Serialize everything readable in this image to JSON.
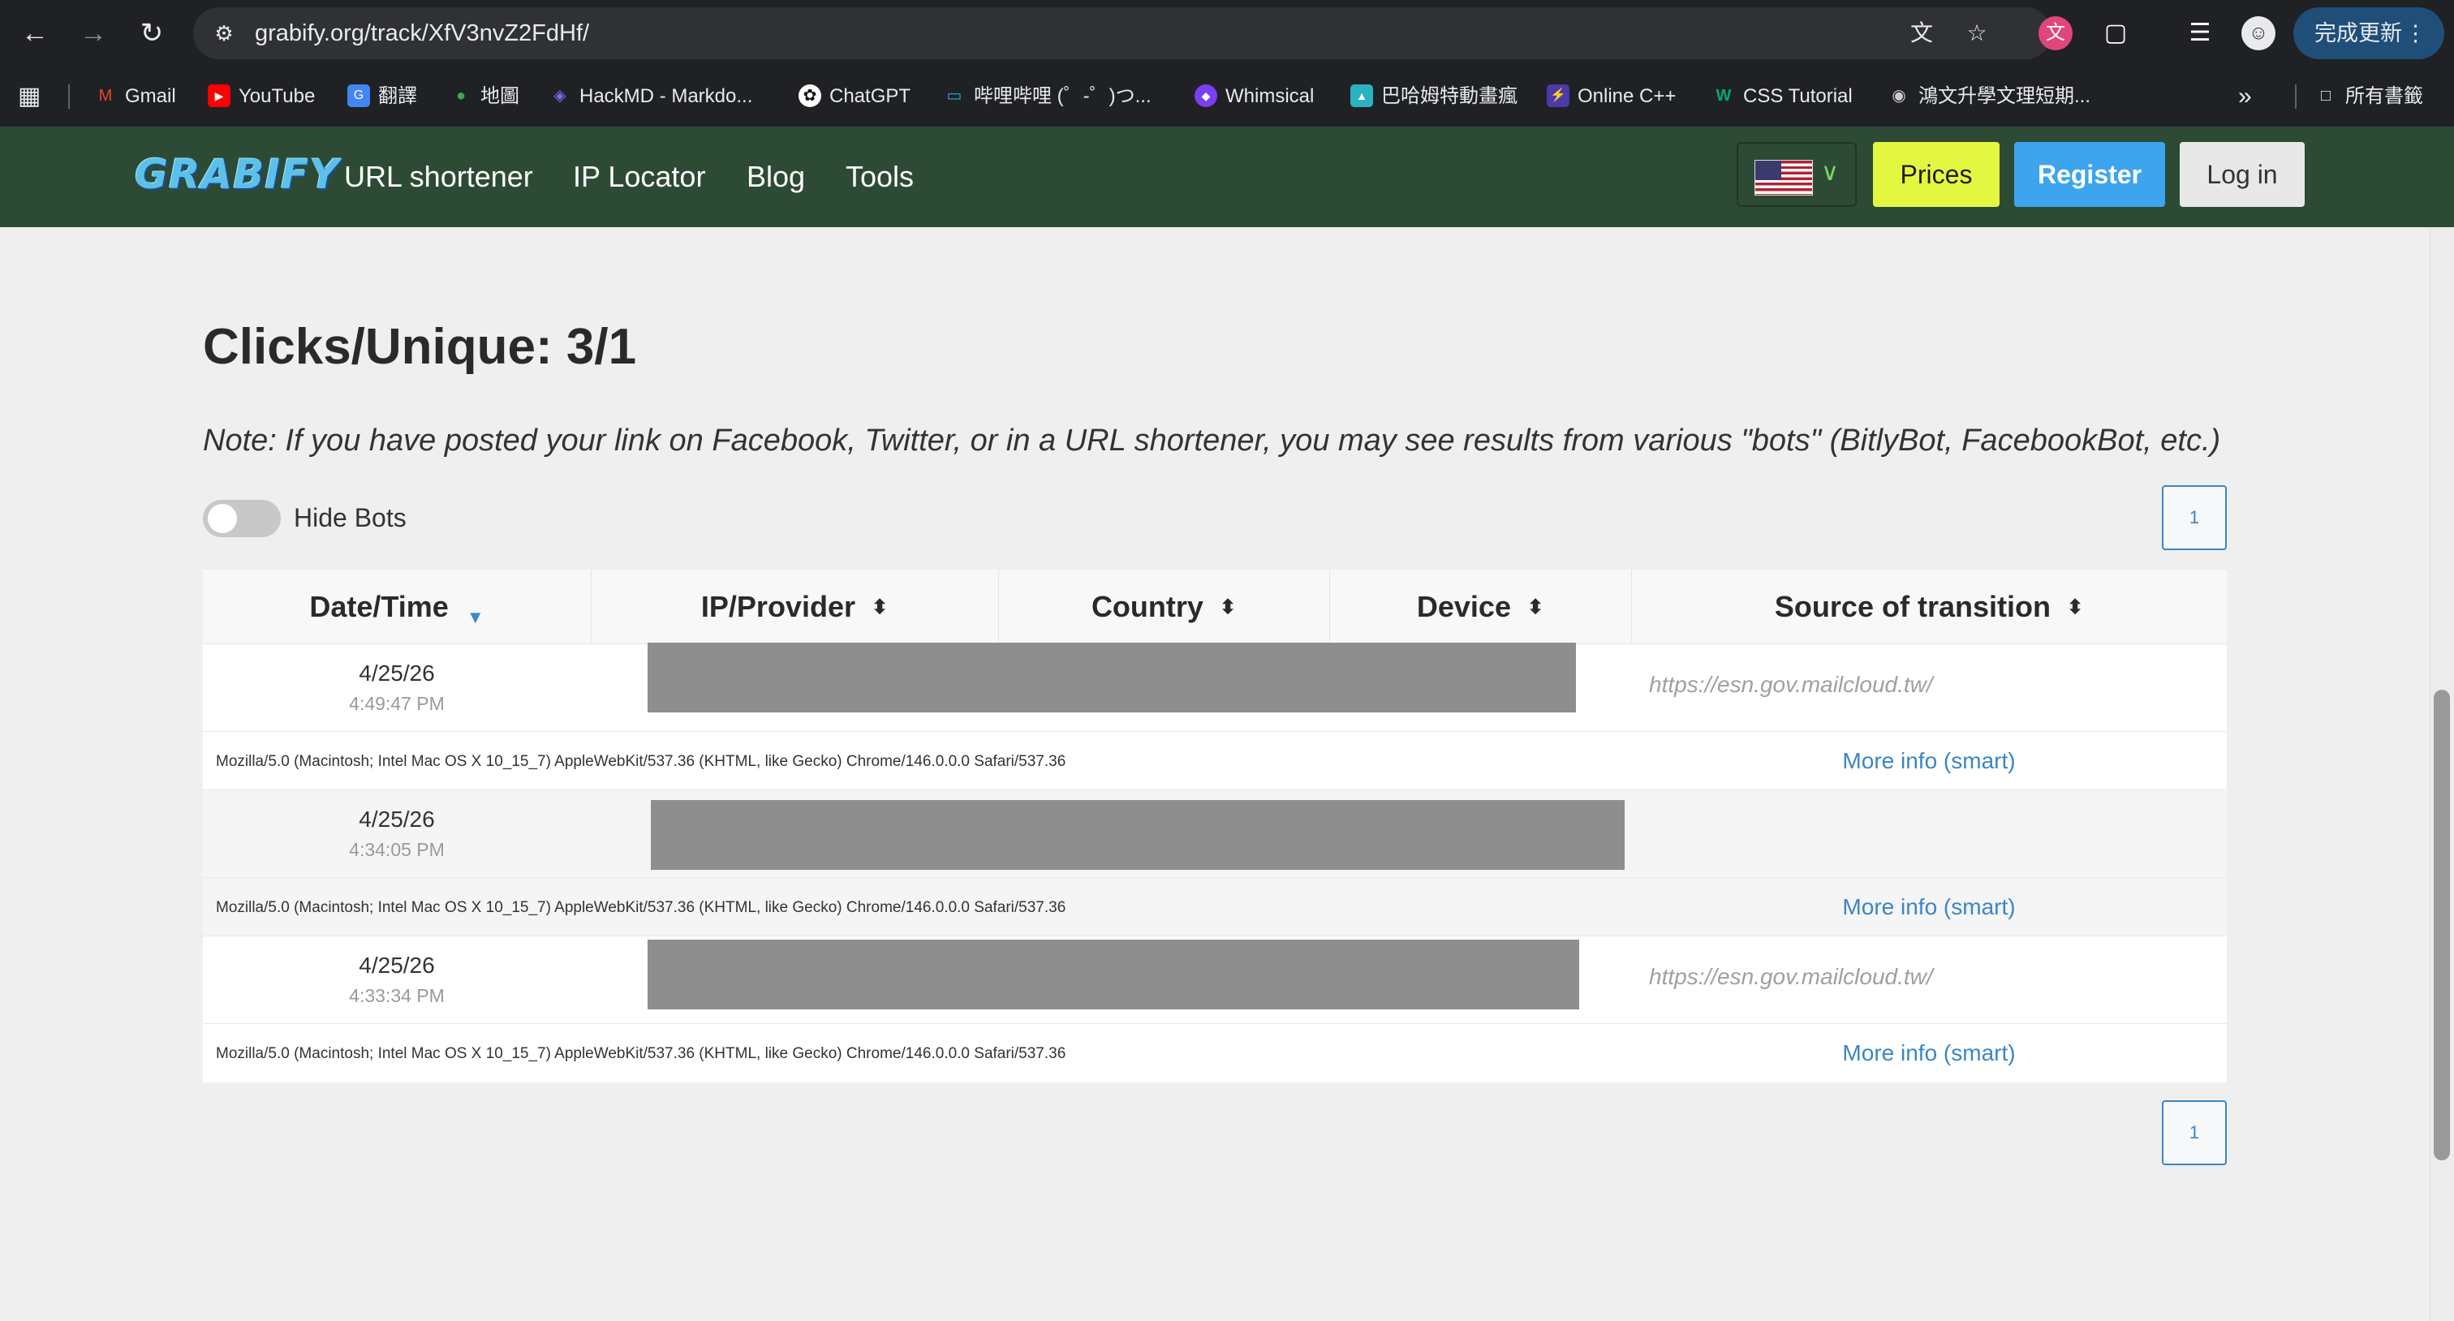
{
  "browser": {
    "url": "grabify.org/track/XfV3nvZ2FdHf/",
    "update_label": "完成更新",
    "bookmarks": [
      {
        "label": "Gmail",
        "icon": "gmail-icon",
        "color": "#ea4335"
      },
      {
        "label": "YouTube",
        "icon": "youtube-icon",
        "color": "#ff0000"
      },
      {
        "label": "翻譯",
        "icon": "translate-icon",
        "color": "#4285f4"
      },
      {
        "label": "地圖",
        "icon": "maps-icon",
        "color": "#34a853"
      },
      {
        "label": "HackMD - Markdo...",
        "icon": "hackmd-icon",
        "color": "#6a5acd"
      },
      {
        "label": "ChatGPT",
        "icon": "chatgpt-icon",
        "color": "#ffffff"
      },
      {
        "label": "哔哩哔哩 (゜-゜)つ...",
        "icon": "bilibili-icon",
        "color": "#23ade5"
      },
      {
        "label": "Whimsical",
        "icon": "whimsical-icon",
        "color": "#7b3ff2"
      },
      {
        "label": "巴哈姆特動畫瘋",
        "icon": "bahamut-icon",
        "color": "#2bb3c0"
      },
      {
        "label": "Online C++",
        "icon": "bolt-icon",
        "color": "#6a4bd8"
      },
      {
        "label": "CSS Tutorial",
        "icon": "w3schools-icon",
        "color": "#04aa6d"
      },
      {
        "label": "鴻文升學文理短期...",
        "icon": "globe-icon",
        "color": "#cccccc"
      }
    ],
    "all_bookmarks_label": "所有書籤"
  },
  "site": {
    "logo": "GRABIFY",
    "nav": [
      "URL shortener",
      "IP Locator",
      "Blog",
      "Tools"
    ],
    "buttons": {
      "prices": "Prices",
      "register": "Register",
      "login": "Log in"
    },
    "colors": {
      "header": "#2d4a35",
      "prices": "#e4f740",
      "register": "#3da4ee",
      "link": "#3a86c8"
    }
  },
  "main": {
    "heading": "Clicks/Unique: 3/1",
    "note": "Note: If you have posted your link on Facebook, Twitter, or in a URL shortener, you may see results from various \"bots\" (BitlyBot, FacebookBot, etc.)",
    "toggle_label": "Hide Bots",
    "page_number": "1",
    "columns": [
      "Date/Time",
      "IP/Provider",
      "Country",
      "Device",
      "Source of transition"
    ],
    "rows": [
      {
        "date": "4/25/26",
        "time": "4:49:47 PM",
        "source": "https://esn.gov.mailcloud.tw/",
        "user_agent": "Mozilla/5.0 (Macintosh; Intel Mac OS X 10_15_7) AppleWebKit/537.36 (KHTML, like Gecko) Chrome/146.0.0.0 Safari/537.36",
        "more_info": "More info (smart)"
      },
      {
        "date": "4/25/26",
        "time": "4:34:05 PM",
        "source": "",
        "user_agent": "Mozilla/5.0 (Macintosh; Intel Mac OS X 10_15_7) AppleWebKit/537.36 (KHTML, like Gecko) Chrome/146.0.0.0 Safari/537.36",
        "more_info": "More info (smart)"
      },
      {
        "date": "4/25/26",
        "time": "4:33:34 PM",
        "source": "https://esn.gov.mailcloud.tw/",
        "user_agent": "Mozilla/5.0 (Macintosh; Intel Mac OS X 10_15_7) AppleWebKit/537.36 (KHTML, like Gecko) Chrome/146.0.0.0 Safari/537.36",
        "more_info": "More info (smart)"
      }
    ]
  }
}
